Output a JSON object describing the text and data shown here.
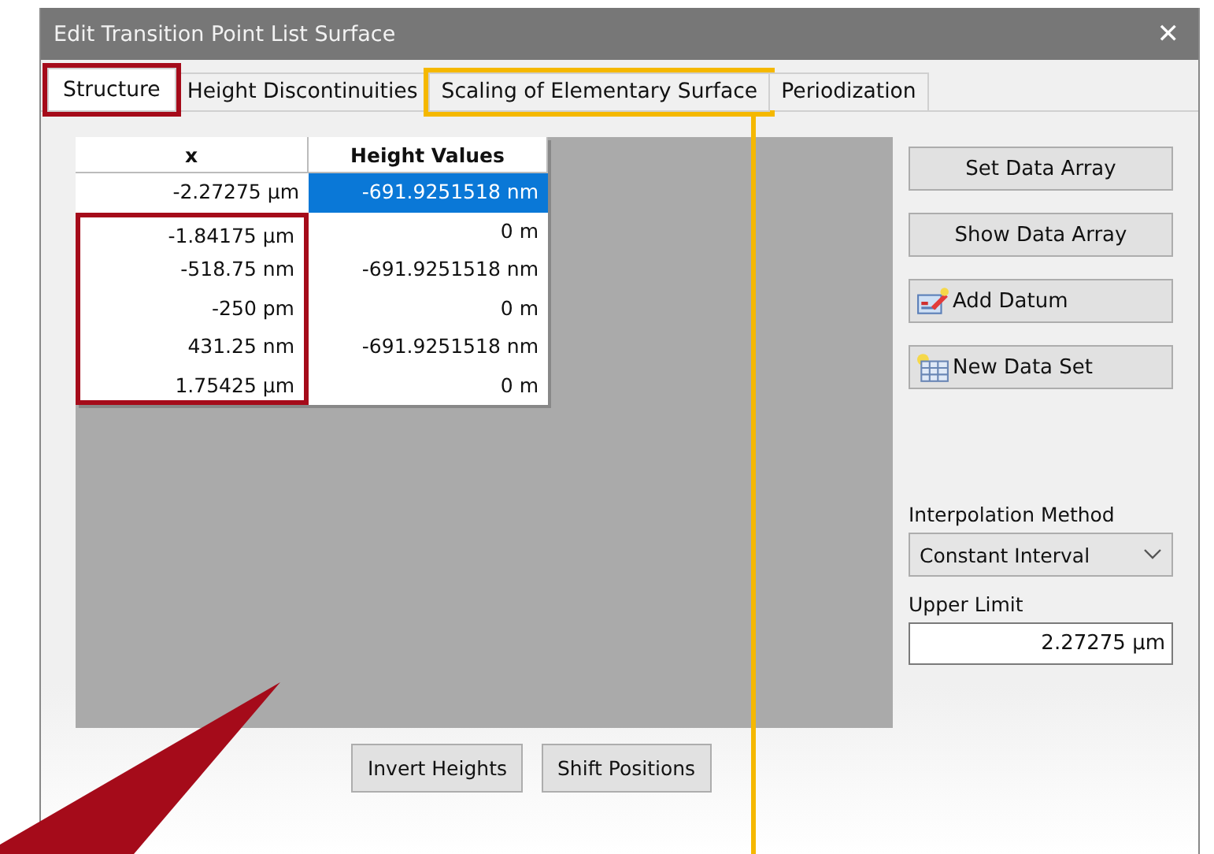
{
  "window": {
    "title": "Edit Transition Point List Surface",
    "close_glyph": "✕"
  },
  "tabs": [
    {
      "label": "Structure",
      "selected": true,
      "color": "#a50b1a"
    },
    {
      "label": "Height Discontinuities",
      "selected": false
    },
    {
      "label": "Scaling of Elementary Surface",
      "selected": false,
      "color": "#f5b800"
    },
    {
      "label": "Periodization",
      "selected": false
    }
  ],
  "table": {
    "columns": [
      "x",
      "Height Values"
    ],
    "rows": [
      {
        "cells": [
          "-2.27275 µm",
          "-691.9251518 nm"
        ],
        "selected": true,
        "highlighted": false
      },
      {
        "cells": [
          "-1.84175 µm",
          "0 m"
        ],
        "selected": false,
        "highlighted": true
      },
      {
        "cells": [
          "-518.75 nm",
          "-691.9251518 nm"
        ],
        "selected": false,
        "highlighted": true
      },
      {
        "cells": [
          "-250 pm",
          "0 m"
        ],
        "selected": false,
        "highlighted": true
      },
      {
        "cells": [
          "431.25 nm",
          "-691.9251518 nm"
        ],
        "selected": false,
        "highlighted": true
      },
      {
        "cells": [
          "1.75425 µm",
          "0 m"
        ],
        "selected": false,
        "highlighted": true
      }
    ]
  },
  "side_buttons": [
    {
      "label": "Set Data Array",
      "kind": "plain"
    },
    {
      "label": "Show Data Array",
      "kind": "plain"
    },
    {
      "label": "Add Datum",
      "kind": "add"
    },
    {
      "label": "New Data Set",
      "kind": "new"
    }
  ],
  "interpolation": {
    "label": "Interpolation Method",
    "value": "Constant Interval"
  },
  "upper_limit": {
    "label": "Upper Limit",
    "value": "2.27275 µm"
  },
  "bottom_buttons": [
    "Invert Heights",
    "Shift Positions"
  ]
}
